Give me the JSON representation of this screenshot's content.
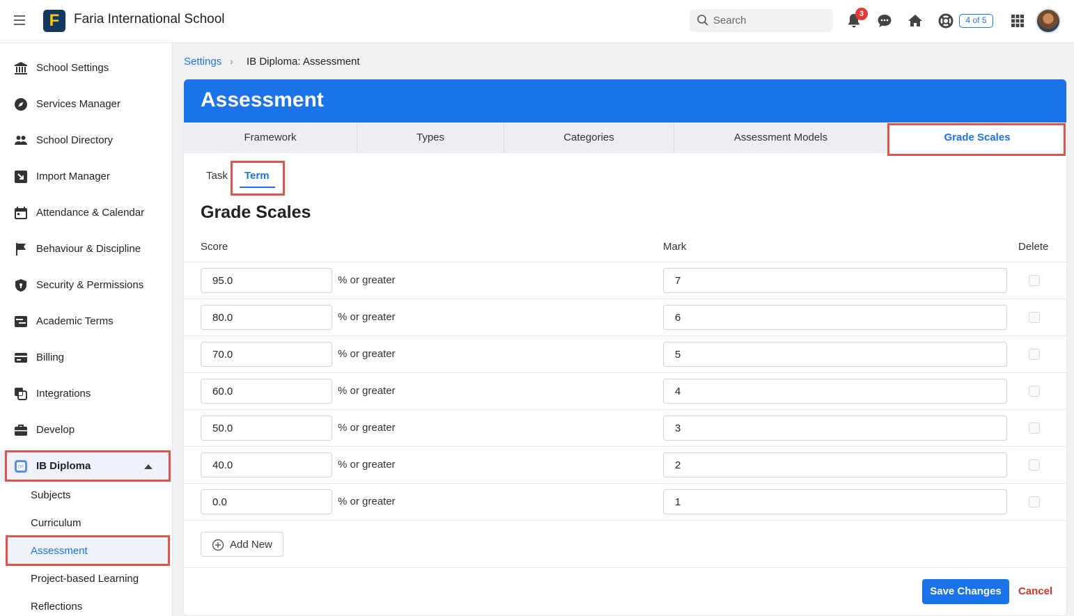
{
  "topbar": {
    "school_name": "Faria International School",
    "logo_letter": "F",
    "search_placeholder": "Search",
    "notification_count": "3",
    "counter_label": "4 of 5"
  },
  "sidebar": {
    "items": [
      {
        "label": "School Settings",
        "icon": "bank-icon"
      },
      {
        "label": "Services Manager",
        "icon": "compass-icon"
      },
      {
        "label": "School Directory",
        "icon": "people-icon"
      },
      {
        "label": "Import Manager",
        "icon": "import-icon"
      },
      {
        "label": "Attendance & Calendar",
        "icon": "calendar-icon"
      },
      {
        "label": "Behaviour & Discipline",
        "icon": "flag-icon"
      },
      {
        "label": "Security & Permissions",
        "icon": "shield-icon"
      },
      {
        "label": "Academic Terms",
        "icon": "terms-icon"
      },
      {
        "label": "Billing",
        "icon": "card-icon"
      },
      {
        "label": "Integrations",
        "icon": "integrations-icon"
      },
      {
        "label": "Develop",
        "icon": "briefcase-icon"
      },
      {
        "label": "IB Diploma",
        "icon": "ib-dp-icon"
      }
    ],
    "sub_items": [
      {
        "label": "Subjects"
      },
      {
        "label": "Curriculum"
      },
      {
        "label": "Assessment"
      },
      {
        "label": "Project-based Learning"
      },
      {
        "label": "Reflections"
      }
    ]
  },
  "breadcrumb": {
    "link": "Settings",
    "current": "IB Diploma: Assessment"
  },
  "card": {
    "title": "Assessment",
    "tabs": [
      {
        "label": "Framework"
      },
      {
        "label": "Types"
      },
      {
        "label": "Categories"
      },
      {
        "label": "Assessment Models"
      },
      {
        "label": "Grade Scales"
      }
    ],
    "subtabs": [
      {
        "label": "Task"
      },
      {
        "label": "Term"
      }
    ],
    "section_title": "Grade Scales",
    "columns": {
      "score": "Score",
      "mark": "Mark",
      "delete": "Delete"
    },
    "score_suffix": "% or greater",
    "rows": [
      {
        "score": "95.0",
        "mark": "7"
      },
      {
        "score": "80.0",
        "mark": "6"
      },
      {
        "score": "70.0",
        "mark": "5"
      },
      {
        "score": "60.0",
        "mark": "4"
      },
      {
        "score": "50.0",
        "mark": "3"
      },
      {
        "score": "40.0",
        "mark": "2"
      },
      {
        "score": "0.0",
        "mark": "1"
      }
    ],
    "add_new_label": "Add New",
    "save_label": "Save Changes",
    "cancel_label": "Cancel"
  },
  "colors": {
    "primary": "#1a73e8",
    "highlight": "#e2534a",
    "danger": "#d93025",
    "badge": "#e53935",
    "logo_bg": "#14395e",
    "logo_fg": "#f5c518"
  }
}
